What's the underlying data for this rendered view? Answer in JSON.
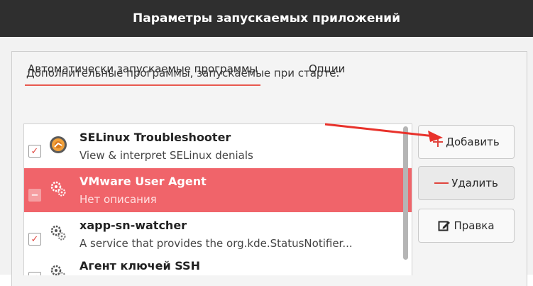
{
  "window": {
    "title": "Параметры запускаемых приложений"
  },
  "tabs": [
    {
      "label": "Автоматически запускаемые программы",
      "active": true
    },
    {
      "label": "Опции",
      "active": false
    }
  ],
  "section_label": "Дополнительные программы, запускаемые при старте:",
  "apps": [
    {
      "name": "SELinux Troubleshooter",
      "description": "View & interpret SELinux denials",
      "enabled": true,
      "selected": false,
      "icon": "selinux-troubleshooter-icon"
    },
    {
      "name": "VMware User Agent",
      "description": "Нет описания",
      "enabled": false,
      "selected": true,
      "icon": "gears-icon"
    },
    {
      "name": "xapp-sn-watcher",
      "description": "A service that provides the org.kde.StatusNotifier...",
      "enabled": true,
      "selected": false,
      "icon": "gears-icon"
    },
    {
      "name": "Агент ключей SSH",
      "description": "",
      "enabled": true,
      "selected": false,
      "icon": "gears-icon"
    }
  ],
  "buttons": {
    "add": "Добавить",
    "remove": "Удалить",
    "edit": "Правка"
  },
  "colors": {
    "accent": "#e8594f",
    "selection": "#f0646a",
    "annotation_arrow": "#e8322b"
  }
}
